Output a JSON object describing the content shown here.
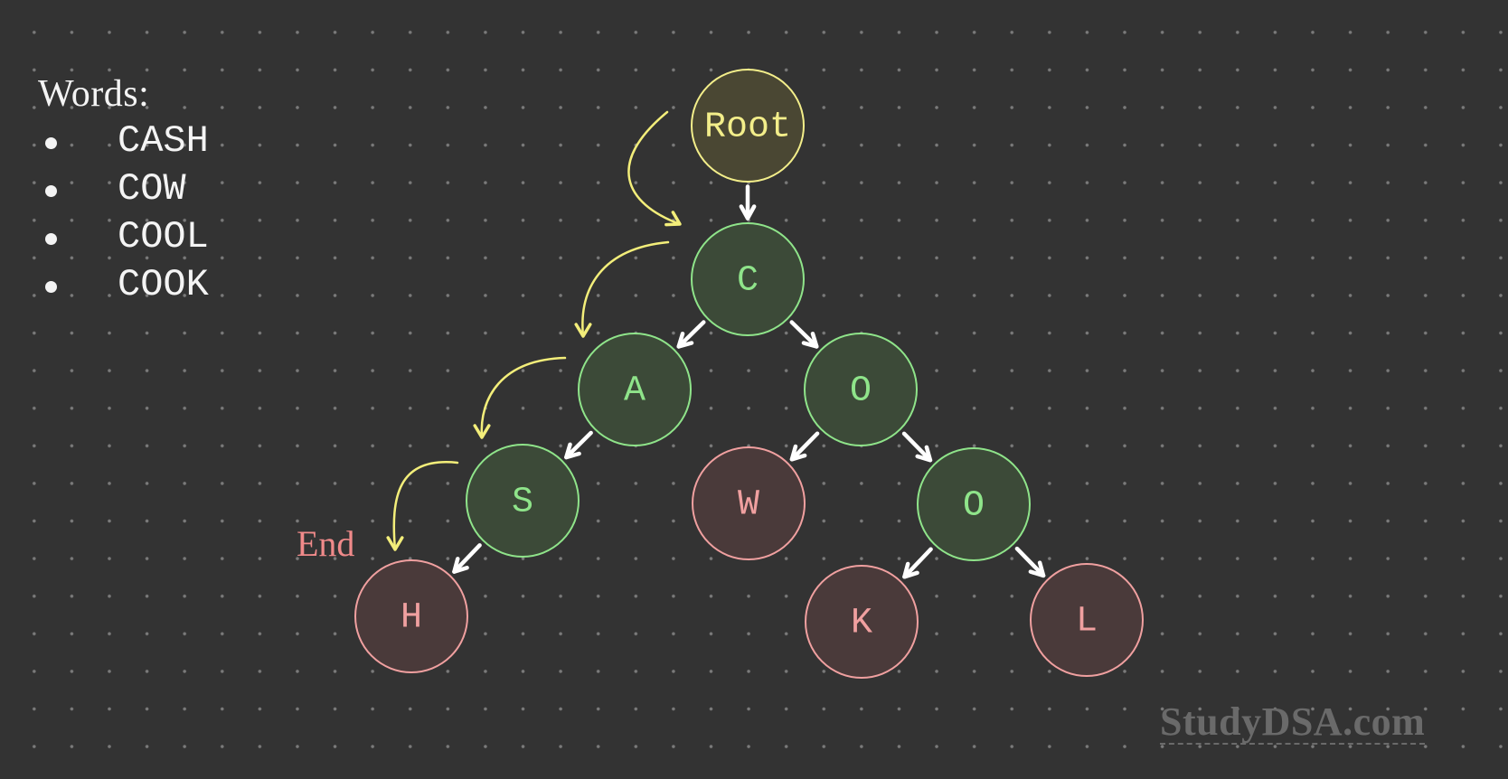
{
  "words": {
    "title": "Words:",
    "items": [
      "CASH",
      "COW",
      "COOL",
      "COOK"
    ]
  },
  "trie": {
    "nodes": [
      {
        "id": "root",
        "label": "Root",
        "type": "root"
      },
      {
        "id": "c",
        "label": "C",
        "type": "inner"
      },
      {
        "id": "a",
        "label": "A",
        "type": "inner"
      },
      {
        "id": "o1",
        "label": "O",
        "type": "inner"
      },
      {
        "id": "s",
        "label": "S",
        "type": "inner"
      },
      {
        "id": "w",
        "label": "W",
        "type": "leaf"
      },
      {
        "id": "o2",
        "label": "O",
        "type": "inner"
      },
      {
        "id": "h",
        "label": "H",
        "type": "leaf"
      },
      {
        "id": "k",
        "label": "K",
        "type": "leaf"
      },
      {
        "id": "l",
        "label": "L",
        "type": "leaf"
      }
    ],
    "edges": [
      [
        "root",
        "c"
      ],
      [
        "c",
        "a"
      ],
      [
        "c",
        "o1"
      ],
      [
        "a",
        "s"
      ],
      [
        "s",
        "h"
      ],
      [
        "o1",
        "w"
      ],
      [
        "o1",
        "o2"
      ],
      [
        "o2",
        "k"
      ],
      [
        "o2",
        "l"
      ]
    ],
    "traversal_path": [
      "root",
      "c",
      "a",
      "s",
      "h"
    ]
  },
  "end_label": "End",
  "colors": {
    "background": "#333333",
    "root_stroke": "#f3ee8a",
    "root_fill": "#4a4733",
    "inner_stroke": "#8fe48a",
    "inner_fill": "#3c4a38",
    "leaf_stroke": "#f0a0a0",
    "leaf_fill": "#4a3a3a",
    "edge_arrow": "#ffffff",
    "path_arrow": "#f3ee7a"
  },
  "watermark": "StudyDSA.com"
}
